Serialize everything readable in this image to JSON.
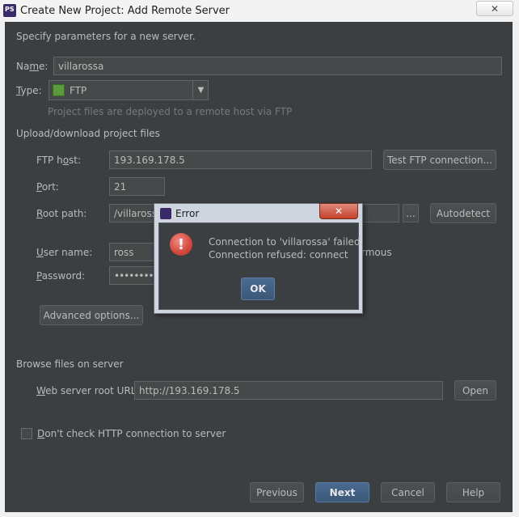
{
  "window": {
    "title": "Create New Project: Add Remote Server",
    "close_glyph": "✕"
  },
  "intro": "Specify parameters for a new server.",
  "name": {
    "label_pre": "Na",
    "label_u": "m",
    "label_post": "e:",
    "value": "villarossa"
  },
  "type": {
    "label_u": "T",
    "label_post": "ype:",
    "value": "FTP",
    "hint": "Project files are deployed to a remote host via FTP"
  },
  "upload_section": "Upload/download project files",
  "ftp_host": {
    "label_pre": "FTP h",
    "label_u": "o",
    "label_post": "st:",
    "value": "193.169.178.5",
    "test_button": "Test FTP connection..."
  },
  "port": {
    "label_u": "P",
    "label_post": "ort:",
    "value": "21"
  },
  "root_path": {
    "label_u": "R",
    "label_post": "oot path:",
    "value": "/villaross",
    "browse": "...",
    "autodetect": "Autodetect"
  },
  "user_name": {
    "label_u": "U",
    "label_post": "ser name:",
    "value": "ross",
    "anonymous_tail": "rmous"
  },
  "password": {
    "label_u": "P",
    "label_post": "assword:",
    "value": "••••••••"
  },
  "advanced_button": "Advanced options...",
  "browse_section": "Browse files on server",
  "web_root": {
    "label_u": "W",
    "label_post": "eb server root URL:",
    "value": "http://193.169.178.5",
    "open_button": "Open"
  },
  "dont_check": {
    "label_u": "D",
    "label_post": "on't check HTTP connection to server"
  },
  "footer": {
    "previous": "Previous",
    "next": "Next",
    "cancel": "Cancel",
    "help": "Help"
  },
  "error_dialog": {
    "title": "Error",
    "close_glyph": "✕",
    "icon_glyph": "!",
    "message_line1": "Connection to 'villarossa' failed.",
    "message_line2": "Connection refused: connect",
    "ok": "OK"
  },
  "colors": {
    "panel": "#3c3f41",
    "field": "#45494a",
    "text": "#bbbbbb",
    "accent": "#3b5878",
    "error": "#d3473c"
  },
  "icons": [
    "phpstorm-app-icon",
    "ftp-icon",
    "dropdown-arrow-icon",
    "error-icon",
    "close-icon"
  ]
}
